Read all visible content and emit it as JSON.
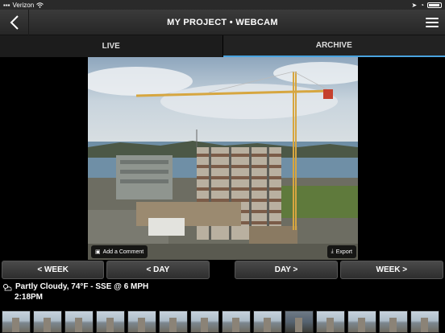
{
  "status_bar": {
    "carrier": "Verizon",
    "time": "",
    "battery_level": 0.9
  },
  "navbar": {
    "title": "MY PROJECT  •  WEBCAM"
  },
  "tabs": [
    {
      "label": "LIVE",
      "active": false
    },
    {
      "label": "ARCHIVE",
      "active": true
    }
  ],
  "viewer": {
    "add_comment_label": "Add a Comment",
    "export_label": "Export"
  },
  "navigation": {
    "prev_week": "< WEEK",
    "prev_day": "< DAY",
    "next_day": "DAY >",
    "next_week": "WEEK >"
  },
  "weather": {
    "icon": "partly-cloudy-icon",
    "conditions": "Partly Cloudy, 74°F - SSE @ 6 MPH",
    "time": "2:18PM"
  },
  "colors": {
    "accent": "#4aa3df",
    "navbar": "#2f2f2f",
    "crane_accent": "#d9452f"
  },
  "filmstrip": {
    "thumbnail_count": 14
  }
}
